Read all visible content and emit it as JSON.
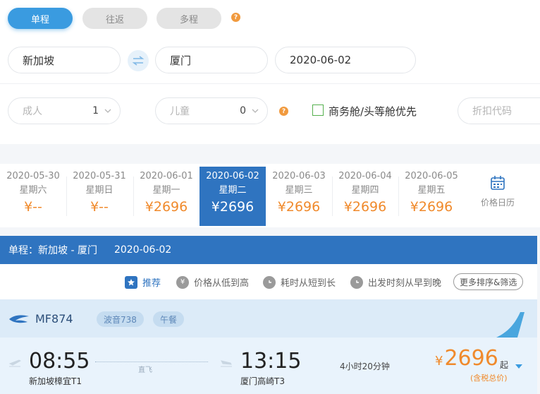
{
  "trip_type": {
    "oneway": "单程",
    "roundtrip": "往返",
    "multicity": "多程",
    "help_glyph": "?"
  },
  "search": {
    "origin": "新加坡",
    "destination": "厦门",
    "date": "2020-06-02"
  },
  "passengers": {
    "adult_label": "成人",
    "adult_count": "1",
    "child_label": "儿童",
    "child_count": "0",
    "business_label": "商务舱/头等舱优先",
    "business_checked": false,
    "promo_placeholder": "折扣代码"
  },
  "date_strip": [
    {
      "date": "2020-05-30",
      "weekday": "星期六",
      "price": "¥--",
      "selected": false
    },
    {
      "date": "2020-05-31",
      "weekday": "星期日",
      "price": "¥--",
      "selected": false
    },
    {
      "date": "2020-06-01",
      "weekday": "星期一",
      "price": "¥2696",
      "selected": false
    },
    {
      "date": "2020-06-02",
      "weekday": "星期二",
      "price": "¥2696",
      "selected": true
    },
    {
      "date": "2020-06-03",
      "weekday": "星期三",
      "price": "¥2696",
      "selected": false
    },
    {
      "date": "2020-06-04",
      "weekday": "星期四",
      "price": "¥2696",
      "selected": false
    },
    {
      "date": "2020-06-05",
      "weekday": "星期五",
      "price": "¥2696",
      "selected": false
    }
  ],
  "price_calendar_label": "价格日历",
  "route_bar": {
    "route": "单程：新加坡 - 厦门",
    "date": "2020-06-02"
  },
  "sort": {
    "recommend": "推荐",
    "price": "价格从低到高",
    "duration": "耗时从短到长",
    "departure": "出发时刻从早到晚",
    "more": "更多排序&筛选"
  },
  "flight": {
    "number": "MF874",
    "aircraft": "波音738",
    "meal": "午餐",
    "depart_time": "08:55",
    "depart_airport": "新加坡樟宜T1",
    "via": "直飞",
    "arrive_time": "13:15",
    "arrive_airport": "厦门高崎T3",
    "duration": "4小时20分钟",
    "price": "2696",
    "price_symbol": "¥",
    "price_suffix": "起",
    "tax_note": "(含税总价)"
  },
  "colors": {
    "accent": "#3a9be0",
    "selected_date": "#2f74c0",
    "price": "#f08a2c",
    "help": "#f19a3e"
  }
}
